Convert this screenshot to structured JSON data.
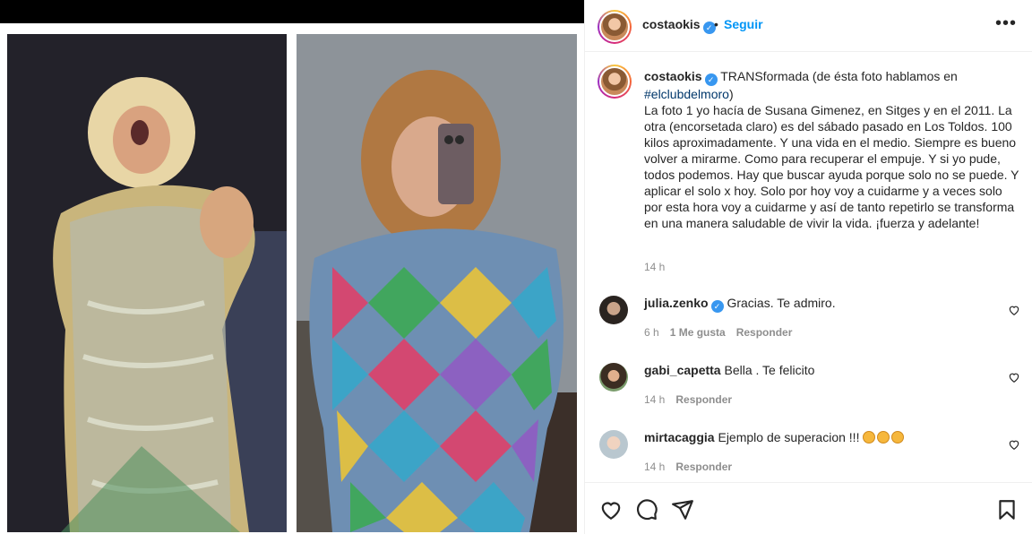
{
  "post": {
    "username": "costaokis",
    "follow_label": "Seguir",
    "dot": "•",
    "more_label": "•••"
  },
  "caption": {
    "username": "costaokis",
    "text_start": "TRANSformada (de ésta foto hablamos en",
    "hashtag": "#elclubdelmoro",
    "text_end": ")",
    "body": "La foto 1 yo hacía de Susana Gimenez, en Sitges y en el 2011. La otra (encorsetada claro) es del sábado pasado en Los Toldos. 100 kilos aproximadamente. Y una vida en el medio. Siempre es bueno volver a mirarme. Como para recuperar el empuje. Y si yo pude, todos podemos. Hay que buscar ayuda porque solo no se puede. Y aplicar el solo x hoy. Solo por hoy voy a cuidarme y a veces solo por esta hora voy a cuidarme y así de tanto repetirlo se transforma en una manera saludable de vivir la vida. ¡fuerza y adelante!",
    "time": "14 h"
  },
  "comments": [
    {
      "username": "julia.zenko",
      "verified": true,
      "text": "Gracias. Te admiro.",
      "time": "6 h",
      "likes": "1 Me gusta",
      "reply": "Responder"
    },
    {
      "username": "gabi_capetta",
      "verified": false,
      "text": "Bella . Te felicito",
      "time": "14 h",
      "reply": "Responder"
    },
    {
      "username": "mirtacaggia",
      "verified": false,
      "text": "Ejemplo de superacion !!!",
      "time": "14 h",
      "reply": "Responder"
    }
  ],
  "icons": {
    "like": "heart-icon",
    "comment": "comment-icon",
    "share": "share-icon",
    "save": "bookmark-icon"
  },
  "colors": {
    "link": "#0095f6",
    "verified": "#3897f0",
    "muted": "#8e8e8e",
    "text": "#262626"
  }
}
